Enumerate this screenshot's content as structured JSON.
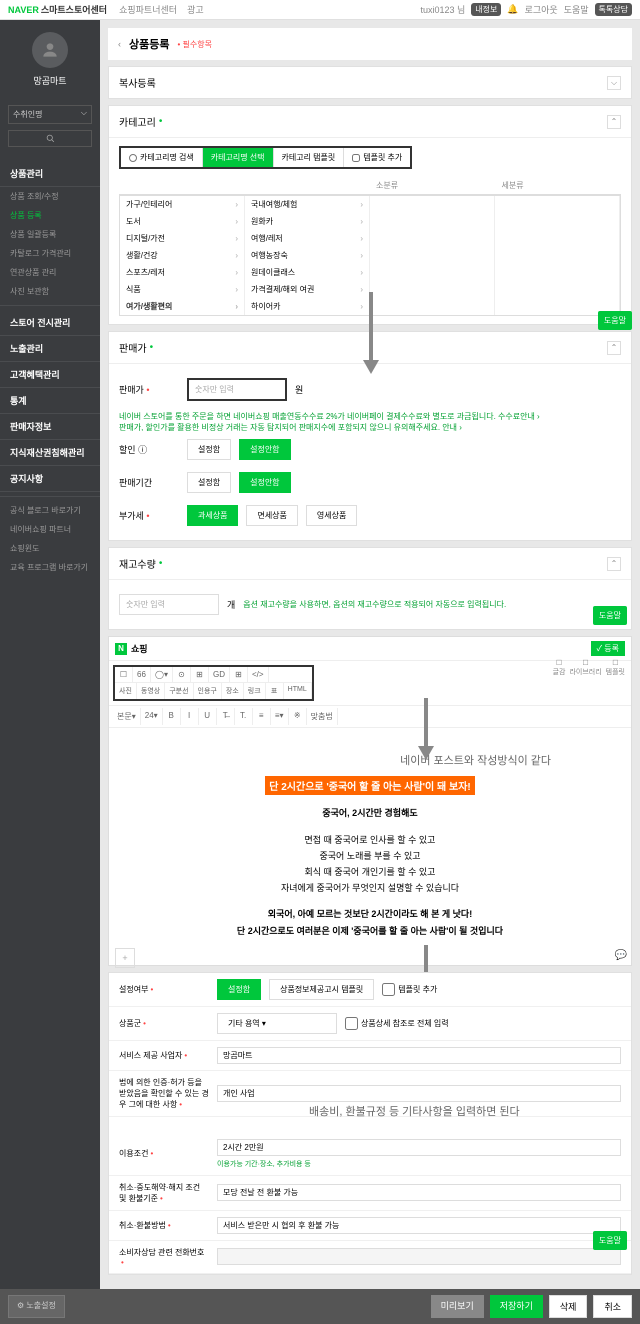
{
  "topbar": {
    "brand": "NAVER",
    "brand2": "스마트스토어센터",
    "tabs": [
      "쇼핑파트너센터",
      "광고"
    ],
    "user": "tuxi0123 님",
    "badge": "내정보",
    "links": [
      "로그아웃",
      "도움말"
    ],
    "chat": "톡톡상담"
  },
  "sidebar": {
    "user": "망곰마트",
    "sel": "수취인명",
    "groups": [
      {
        "h": "상품관리",
        "items": [
          "상품 조회/수정",
          "상품 등록",
          "상품 일괄등록",
          "카탈로그 가격관리",
          "연관상품 관리",
          "사진 보관함"
        ],
        "active": 1
      },
      {
        "h": "스토어 전시관리"
      },
      {
        "h": "노출관리"
      },
      {
        "h": "고객혜택관리"
      },
      {
        "h": "통계"
      },
      {
        "h": "판매자정보"
      },
      {
        "h": "지식재산권침해관리"
      },
      {
        "h": "공지사항"
      }
    ],
    "links": [
      "공식 블로그 바로가기",
      "네이버쇼핑 파트너",
      "쇼핑윈도",
      "교육 프로그램 바로가기"
    ]
  },
  "page": {
    "title": "상품등록",
    "req": "• 필수항목",
    "back": "‹"
  },
  "panels": {
    "copy": {
      "title": "복사등록"
    },
    "category": {
      "title": "카테고리",
      "dot": "•",
      "tabs": [
        "카테고리명 검색",
        "카테고리명 선택",
        "카테고리 탬플릿",
        "템플릿 추가"
      ],
      "cols": [
        [
          "가구/인테리어",
          "도서",
          "디지털/가전",
          "생활/건강",
          "스포츠/레저",
          "식품",
          "여가/생활편의"
        ],
        [
          "국내여행/체험",
          "원화카",
          "여행/레저",
          "여행농장숙",
          "원데이클래스",
          "가격결제/해외 여권",
          "하이어카"
        ],
        [
          "소분류"
        ],
        [
          "세분류"
        ]
      ]
    },
    "price": {
      "title": "판매가",
      "dot": "•",
      "price_lbl": "판매가",
      "price_ph": "숫자만 입력",
      "won": "원",
      "note1": "네이버 스토어를 통한 주문을 하면 네이버쇼핑 매출연동수수료 2%가 네이버페이 결제수수료와 별도로 과금됩니다. 수수료안내 ›",
      "note2": "판매가, 할인가를 활용한 비정상 거래는 자동 탐지되어 판매지수에 포함되지 않으니 유의해주세요. 안내 ›",
      "discount_lbl": "할인",
      "set": "설정함",
      "unset": "설정안함",
      "period_lbl": "판매기간",
      "vat_lbl": "부가세",
      "vat1": "과세상품",
      "vat2": "면세상품",
      "vat3": "영세상품"
    },
    "stock": {
      "title": "재고수량",
      "dot": "•",
      "ph": "숫자만 입력",
      "unit": "개",
      "note": "옵션 재고수량을 사용하면, 옵션의 재고수량으로 적용되어 자동으로 입력됩니다."
    }
  },
  "editor": {
    "logo": "N",
    "title": "쇼핑",
    "save": "✓ 등록",
    "tb_top": [
      "사진",
      "동영상",
      "구분선",
      "인용구",
      "장소",
      "링크",
      "표",
      "HTML"
    ],
    "tb_icons": [
      "☐",
      "66",
      "◯▾",
      "⊙",
      "⊞",
      "GD",
      "⊞",
      "</>"
    ],
    "tb_bot": [
      "본문▾",
      "24▾",
      "B",
      "I",
      "U",
      "T̶",
      "T.",
      "≡",
      "≡▾",
      "※",
      "맞춤법"
    ],
    "side": [
      "글감",
      "라이브러리",
      "템플릿"
    ],
    "annot1": "네이버 포스트와 작성방식이 같다",
    "highlight": "단 2시간으로 '중국어 할 줄 아는 사람'이 돼 보자!",
    "body1": "중국어, 2시간만 경험해도",
    "body2": "면접 때 중국어로 인사를 할 수 있고\n중국어 노래를 부를 수 있고\n회식 때 중국어 개인기를 할 수 있고\n자녀에게 중국어가 무엇인지 설명할 수 있습니다",
    "body3": "외국어, 아예 모르는 것보단 2시간이라도 해 본 게 낫다!\n단 2시간으로도 여러분은 이제 '중국어를 할 줄 아는 사람'이 될 것입니다"
  },
  "form": {
    "setting_lbl": "설정여부",
    "set": "설정함",
    "opt2": "상품정보제공고시 템플릿",
    "opt3": "템플릿 추가",
    "group_lbl": "상품군",
    "group_val": "기타 용역",
    "group_chk": "상품상세 참조로 전체 입력",
    "biz_lbl": "서비스 제공 사업자",
    "biz_val": "망곰마트",
    "law_lbl": "법에 의한 인증·허가 등을 받았음을 확인할 수 있는 경우 그에 대한 사항",
    "law_val": "개인 사업",
    "annot2": "배송비, 환불규정 등 기타사항을 입력하면 된다",
    "use_lbl": "이용조건",
    "use_val": "2시간 2만원",
    "use_hint": "이용가능 기간·장소, 추가비용 등",
    "cancel_lbl": "취소·중도해약·해지 조건 및 환불기준",
    "cancel_val": "모당 전날 전 환불 가능",
    "refund_lbl": "취소·환불방법",
    "refund_val": "서비스 받은만 시 협의 후 환불 가능",
    "phone_lbl": "소비자상담 관련 전화번호"
  },
  "help": "도움말",
  "footer": {
    "expose": "⚙ 노출설정",
    "preview": "미리보기",
    "save": "저장하기",
    "delete": "삭제",
    "cancel": "취소"
  }
}
